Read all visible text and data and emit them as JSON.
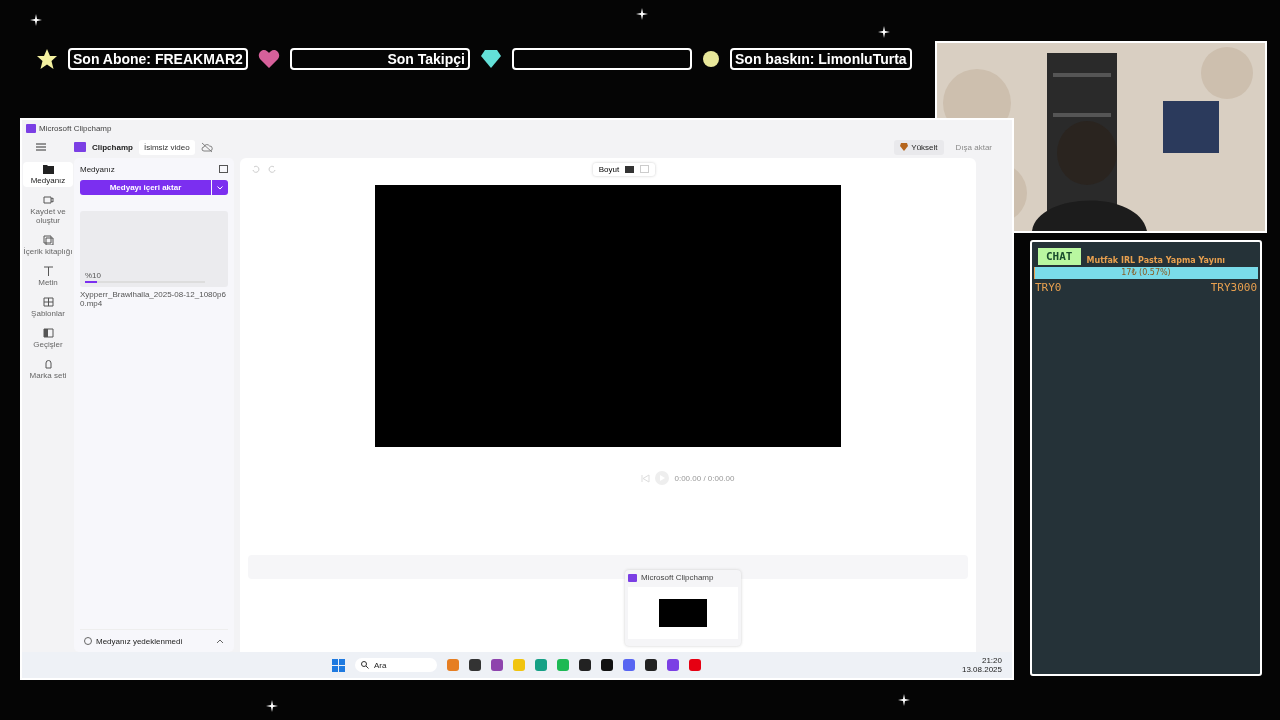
{
  "overlay": {
    "alerts": [
      {
        "kind": "star",
        "text": "Son Abone: FREAKMAR2"
      },
      {
        "kind": "heart",
        "text": "Son Takipçi"
      },
      {
        "kind": "diamond"
      },
      {
        "kind": "coin",
        "text": "Son baskın: LimonluTurta"
      }
    ]
  },
  "chat": {
    "title": "CHAT",
    "goal": {
      "title": "Mutfak IRL Pasta Yapma Yayını",
      "progress": "17₺ (0.57%)",
      "level": 0.0057,
      "min": "TRY0",
      "max": "TRY3000"
    }
  },
  "window": {
    "title": "Microsoft Clipchamp"
  },
  "app": {
    "name": "Clipchamp",
    "project": "İsimsiz video",
    "upgrade": "Yükselt",
    "export": {
      "label": "Dışa aktar",
      "disabled": true
    }
  },
  "nav": [
    {
      "label": "Medyanız",
      "selected": true
    },
    {
      "label": "Kaydet ve oluştur",
      "selected": false
    },
    {
      "label": "İçerik kitaplığı",
      "selected": false
    },
    {
      "label": "Metin",
      "selected": false
    },
    {
      "label": "Şablonlar",
      "selected": false
    },
    {
      "label": "Geçişler",
      "selected": false
    },
    {
      "label": "Marka seti",
      "selected": false
    }
  ],
  "media": {
    "title": "Medyanız",
    "import": "Medyayı içeri aktar",
    "items": [
      {
        "progress": "%10",
        "level": 0.1,
        "name": "Xypperr_Brawlhalla_2025-08-12_1080p60.mp4"
      }
    ],
    "backup": "Medyanız yedeklenmedi"
  },
  "editor": {
    "aspect": "Boyut",
    "time": "0:00.00 / 0:00.00"
  },
  "preview_popup": {
    "title": "Microsoft Clipchamp"
  },
  "taskbar": {
    "search": "Ara",
    "time": "21:20",
    "date": "13.08.2025"
  }
}
